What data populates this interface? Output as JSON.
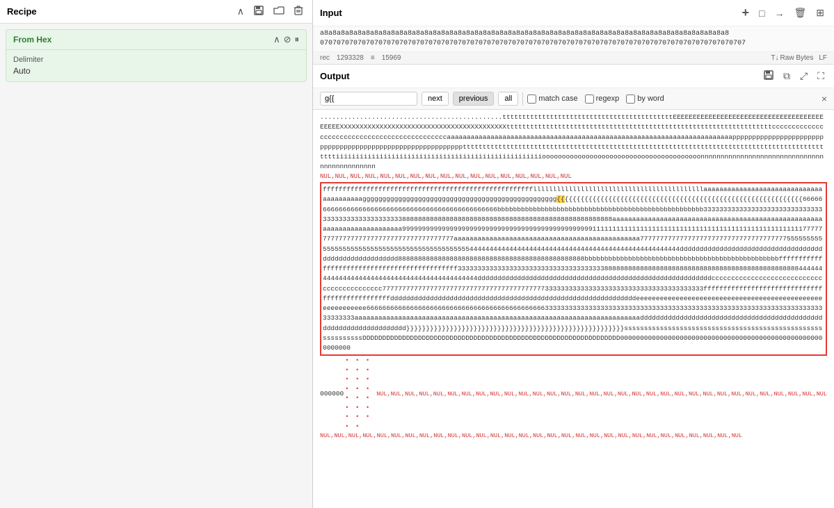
{
  "left": {
    "recipe_title": "Recipe",
    "from_hex_title": "From Hex",
    "delimiter_label": "Delimiter",
    "delimiter_value": "Auto"
  },
  "input": {
    "title": "Input",
    "content_line1": "a8a8a8a8a8a8a8a8a8a8a8a8a8a8a8a8a8a8a8a8a8a8a8a8a8a8a8a8a8a8a8a8a8a8a8a8a8a8a8a8a8a8a8a8a8a8a8a8a8",
    "content_line2": "070707070707070707070707070707070707070707070707070707070707070707070707070707070707070707070707070707",
    "rec_label": "rec",
    "rec_value": "1293328",
    "lines_icon": "≡",
    "lines_value": "15969",
    "raw_bytes": "Raw Bytes",
    "lf": "LF"
  },
  "output": {
    "title": "Output",
    "search_placeholder": "g{{",
    "btn_next": "next",
    "btn_previous": "previous",
    "btn_all": "all",
    "cb_match_case": "match case",
    "cb_regexp": "regexp",
    "cb_by_word": "by word",
    "content_before": "..............................................tttttttttttttttttttttttttttttttttttttttttttEEEEEEEEEEEEEEEEEEEEEEEEEEEEEEEEEEEEEEEEEEEXXXXXXXXXXXXXXXXXXXXXXXXXXXXXXXXXXXXXXXXXXtttttttttttttttttttttttttttttttttttttttttttttttttttttttttttttttttttcccccccccccccccccccccccccccccccccccccccccccccaaaaaaaaaaaaaaaaaaaaaaaaaaaaaaaaaaaaaaaaaaaaaaaaaaaaaaaaaaaaaaaaaaaaaaaappppppppppppppppppppppppppppppppppppppppppppppppppppppppppptttttttttttttttttttttttttttttttttttttttttttttttttttttttttttttttttttttttttttttttttttttttttttttttiiiiiiiiiiiiiiiiiiiiiiiiiiiiiiiiiiiiiiiiiiiiiiiiiiiioooooooooooooooooooooooooooooooooooooooonnnnnnnnnnnnnnnnnnnnnnnnnnnnnnnnnnnnnnnnnnnnn",
    "null_line_before": "NUL,NUL,NUL,NUL,NUL,NUL,NUL,NUL,NUL,NUL,NUL,NUL,NUL,NUL,NUL,NUL,NUL",
    "highlight_content": "ffffffffffffffffffffffffffffffffffffffffffffffffffffflllllllllllllllllllllllllllllllllllllllllllaaaaaaaaaaaaaaaaaaaaaaaaaaaaaaaaaaaaaaaaggggggggggggggggggggggggggggggggggggggggggggggggg{{{{{{{{{{{{{{{{{{{{{{{{{{{{{{{{{{{{{{{{{{{{{{{{{{{{{{{{{{{{{{{{{{{66666666666666666666666666666666666666666666666bbbbbbbbbbbbbbbbbbbbbbbbbbbbbbbbbbbbbbbbbbbbb3333333333333333333333333333333333333333338888888888888888888888888888888888888888888888888aaaaaaaaaaaaaaaaaaaaaaaaaaaaaaaaaaaaaaaaaaaaaaaaaaaaaaaaaaaaaaaaaaaaaaaaaaaa9999999999999999999999999999999999999999999999999911111111111111111111111111111111111111111111111777777777777777777777777777777777777777aaaaaaaaaaaaaaaaaaaaaaaaaaaaaaaaaaaaaaaaaaaa7777777777777777777777777777777777555555555555555555555555555555555555555555555544444444444444444444444444444444444444444444444444444444ddddddddddddddddddddddddddddddddddddddddddddddddddddddd88888888888888888888888888888888888888888888888bbbbbbbbbbbbbbbbbbbbbbbbbbbbbbbbbbbbbbbbbbbbbbbbbffffffffffffffffffffffffffffffffffffffffff33333333333333333333333333333333333333888888888888888888888888888888888888888888444444444444444444444444444444444444444444444ddddddddddddddddddddddddddddddddddddddddddddddddddddddddccccccccccccccccccccccccccccccccccccccccccc777777777777777777777777777777777777777773333333333333333333333333333333333333333fffffffffffffffffffffffffffffffffffffffffffddddddddddddddddddddddddddddddddddddddddddddddddddddddddddeeeeeeeeeeeeeeeeeeeeeeeeeeeeeeeeeeeeeeeeeeeeeeeeeeeeeeeee6666666666666666666666666666666666666666333333333333333333333333333333333333333333333333333333333333333333333333333333aaaaaaaaaaaaaaaaaaaaaaaaaaaaaaaaaaaaaaaaaaaaaaaaaaaaaaaaaaaaaaaaaaddddddddddddddddddddddddddddddddddddddddddddddddddddddddddddddddd}}}}}}}}}}}}}}}}}}}}}}}}}}}}}}}}}}}}}}}}}}}}}}}}}}}}}}}ssssssssssssssssssssssssssssssssssssssssssssssssssssssssssssDDDDDDDDDDDDDDDDDDDDDDDDDDDDDDDDDDDDDDDDDDDDDDDDDDDDDDDDDDDDD0000000000000000000000000000000000000000000000000000000000",
    "bottom_line": "000000",
    "dot_line": "• • • • • • • • • • • • • • • • • • • • • • •",
    "null_line_after": "NUL,NUL,NUL,NUL,NUL,NUL,NUL,NUL,NUL,NUL,NUL,NUL,NUL,NUL,NUL,NUL,NUL,NUL,NUL,NUL,NUL,NUL,NUL,NUL,NUL,NUL,NUL,NUL,NUL,NUL,NUL,NUL",
    "null_line_bottom": "NUL,NUL,NUL,NUL,NUL,NUL,NUL,NUL,NUL,NUL,NUL,NUL,NUL,NUL,NUL,NUL,NUL,NUL,NUL,NUL,NUL,NUL,NUL,NUL,NUL,NUL,NUL,NUL,NUL,NUL"
  }
}
